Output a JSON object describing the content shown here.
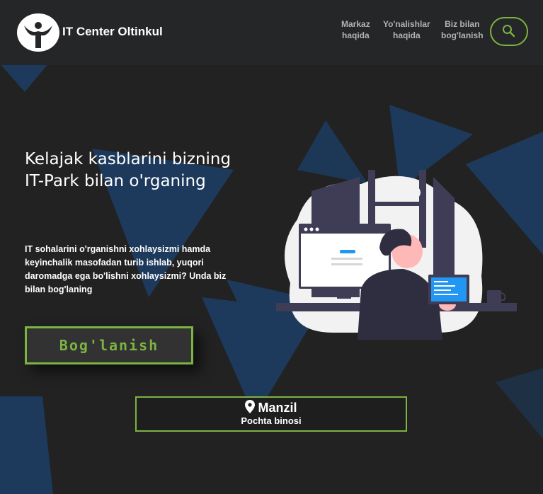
{
  "header": {
    "brand": "IT Center Oltinkul",
    "nav": [
      {
        "line1": "Markaz",
        "line2": "haqida"
      },
      {
        "line1": "Yo'nalishlar",
        "line2": "haqida"
      },
      {
        "line1": "Biz bilan",
        "line2": "bog'lanish"
      }
    ],
    "search_icon": "search-icon"
  },
  "hero": {
    "title": "Kelajak kasblarini bizning IT-Park bilan o'rganing",
    "text": "IT sohalarini o'rganishni xohlaysizmi hamda keyinchalik masofadan turib ishlab, yuqori daromadga ega bo'lishni xohlaysizmi? Unda biz bilan bog'laning",
    "button": "Bog'lanish"
  },
  "address": {
    "icon": "map-pin-icon",
    "title": "Manzil",
    "subtitle": "Pochta binosi"
  },
  "colors": {
    "background": "#222222",
    "header": "#252628",
    "accent": "#7cb342",
    "shape": "#1d3a5c"
  }
}
